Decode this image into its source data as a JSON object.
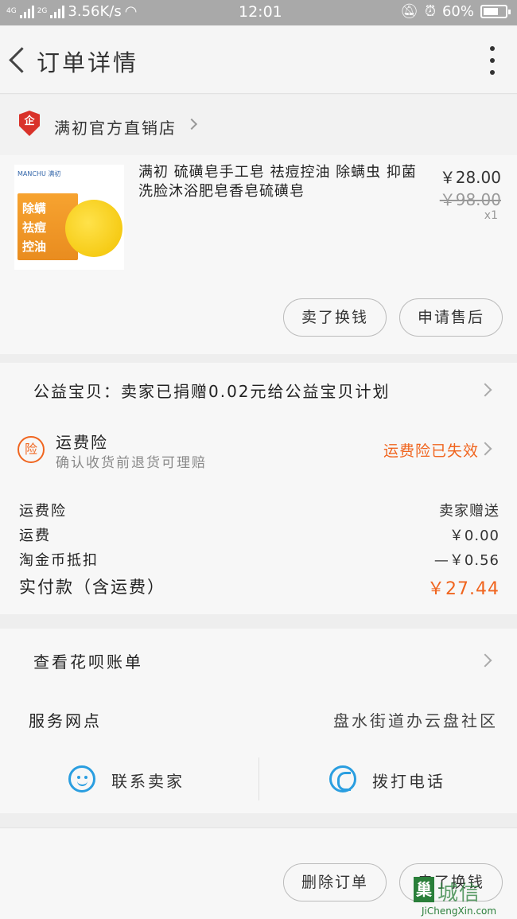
{
  "status_bar": {
    "signal1": "4G",
    "signal2": "2G",
    "net_speed": "3.56K/s",
    "time": "12:01",
    "battery": "60%"
  },
  "nav": {
    "title": "订单详情"
  },
  "shop": {
    "logo_text": "企",
    "name": "满初官方直销店"
  },
  "product": {
    "image_brand": "MANCHU 满初",
    "image_lines": [
      "除螨",
      "祛痘",
      "控油"
    ],
    "title": "满初 硫磺皂手工皂 祛痘控油 除螨虫 抑菌 洗脸沐浴肥皂香皂硫磺皂",
    "price": "￥28.00",
    "original_price": "￥98.00",
    "quantity": "x1",
    "buttons": {
      "sell": "卖了换钱",
      "after_sale": "申请售后"
    }
  },
  "charity": {
    "text": "公益宝贝：卖家已捐赠0.02元给公益宝贝计划"
  },
  "insurance": {
    "icon_text": "险",
    "title": "运费险",
    "subtitle": "确认收货前退货可理赔",
    "status": "运费险已失效"
  },
  "costs": {
    "rows": [
      {
        "label": "运费险",
        "value": "卖家赠送"
      },
      {
        "label": "运费",
        "value": "￥0.00"
      },
      {
        "label": "淘金币抵扣",
        "value": "—￥0.56"
      }
    ],
    "total_label": "实付款（含运费）",
    "total_value": "￥27.44"
  },
  "services": {
    "bill_link": "查看花呗账单",
    "service_label": "服务网点",
    "service_value": "盘水街道办云盘社区",
    "contact_seller": "联系卖家",
    "call_phone": "拨打电话"
  },
  "footer": {
    "delete_order": "删除订单",
    "sell": "卖了换钱"
  },
  "watermark": {
    "cn": "城信",
    "box": "巢",
    "en": "JiChengXin.com"
  },
  "colors": {
    "accent_orange": "#f0651f",
    "icon_blue": "#2a9ee0",
    "shop_red": "#d9322a"
  }
}
